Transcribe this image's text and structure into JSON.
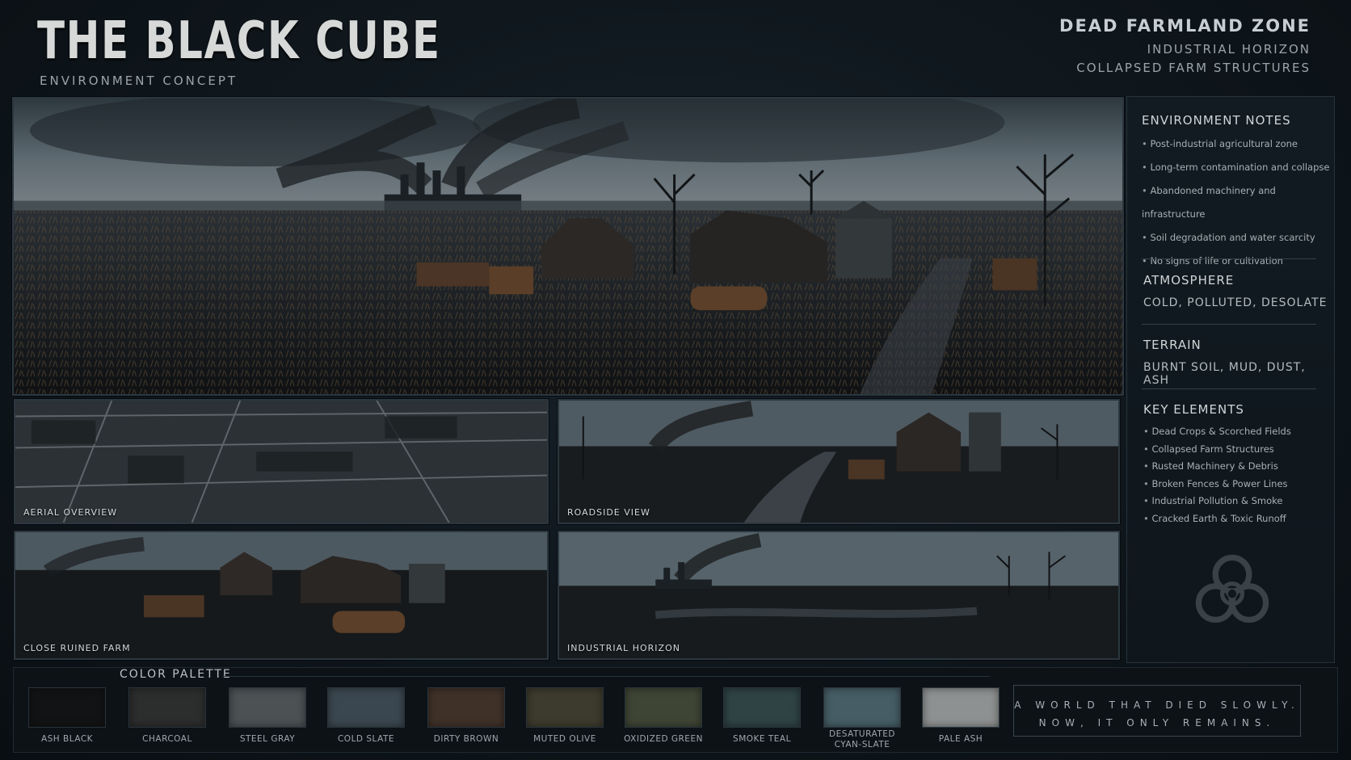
{
  "header": {
    "title": "THE BLACK CUBE",
    "subtitle": "ENVIRONMENT CONCEPT",
    "zone_title": "DEAD FARMLAND ZONE",
    "zone_line1": "INDUSTRIAL HORIZON",
    "zone_line2": "COLLAPSED FARM STRUCTURES"
  },
  "panels": {
    "aerial": "AERIAL OVERVIEW",
    "roadside": "ROADSIDE VIEW",
    "close_farm": "CLOSE RUINED FARM",
    "industrial": "INDUSTRIAL HORIZON"
  },
  "sidebar": {
    "notes_title": "ENVIRONMENT NOTES",
    "notes": [
      "Post-industrial agricultural zone",
      "Long-term contamination and collapse",
      "Abandoned machinery and infrastructure",
      "Soil degradation and water scarcity",
      "No signs of life or cultivation"
    ],
    "atmosphere_title": "ATMOSPHERE",
    "atmosphere_value": "COLD, POLLUTED, DESOLATE",
    "terrain_title": "TERRAIN",
    "terrain_value": "BURNT SOIL, MUD, DUST, ASH",
    "key_title": "KEY ELEMENTS",
    "keys": [
      "Dead Crops & Scorched Fields",
      "Collapsed Farm Structures",
      "Rusted Machinery & Debris",
      "Broken Fences & Power Lines",
      "Industrial Pollution & Smoke",
      "Cracked Earth & Toxic Runoff"
    ],
    "emblem_icon": "biohazard-icon"
  },
  "palette": {
    "title": "COLOR PALETTE",
    "swatches": [
      {
        "label": "ASH BLACK",
        "color": "#121314"
      },
      {
        "label": "CHARCOAL",
        "color": "#2c2d2d"
      },
      {
        "label": "STEEL GRAY",
        "color": "#4c5154"
      },
      {
        "label": "COLD SLATE",
        "color": "#3b4750"
      },
      {
        "label": "DIRTY BROWN",
        "color": "#3f3128"
      },
      {
        "label": "MUTED OLIVE",
        "color": "#3d3b2d"
      },
      {
        "label": "OXIDIZED GREEN",
        "color": "#3f4535"
      },
      {
        "label": "SMOKE TEAL",
        "color": "#2f4345"
      },
      {
        "label": "DESATURATED CYAN-SLATE",
        "color": "#465d65"
      },
      {
        "label": "PALE ASH",
        "color": "#8e9191"
      }
    ]
  },
  "quote": {
    "line1": "A WORLD THAT DIED SLOWLY.",
    "line2": "NOW, IT ONLY REMAINS."
  }
}
